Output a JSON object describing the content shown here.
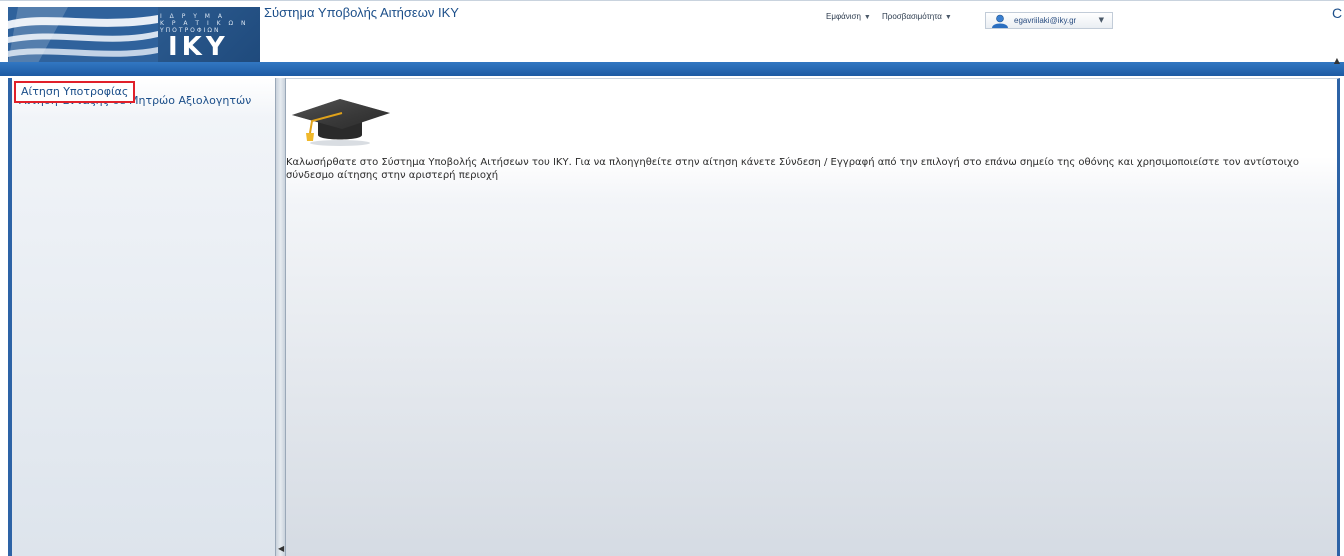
{
  "header": {
    "logo": {
      "line1": "Ι Δ Ρ Υ Μ Α",
      "line2": "Κ Ρ Α Τ Ι Κ Ω Ν",
      "line3": "ΥΠΟΤΡΟΦΙΩΝ",
      "name": "IKY"
    },
    "app_title": "Σύστημα Υποβολής Αιτήσεων ΙΚΥ",
    "menu": {
      "appearance": "Εμφάνιση",
      "preferences": "Προσβασιμότητα"
    },
    "user": {
      "email": "egavriilaki@iky.gr"
    },
    "corner_glyph": "C"
  },
  "sidebar": {
    "items": [
      {
        "label": "Αίτηση Υποτροφίας"
      },
      {
        "label": "Αίτηση Ένταξης σε Μητρώο Αξιολογητών"
      }
    ]
  },
  "main": {
    "welcome_text": "Καλωσήρθατε στο Σύστημα Υποβολής Αιτήσεων του ΙΚΥ. Για να πλοηγηθείτε στην αίτηση κάνετε Σύνδεση / Εγγραφή από την επιλογή στο επάνω σημείο της οθόνης και χρησιμοποιείστε τον αντίστοιχο σύνδεσμο αίτησης στην αριστερή περιοχή"
  },
  "icons": {
    "graduation_cap": "graduation-cap-icon",
    "user": "user-icon",
    "caret": "chevron-down-icon"
  },
  "colors": {
    "brand_blue": "#1d5aa3",
    "link_blue": "#1c4f8a",
    "highlight_red": "#e0202a"
  }
}
